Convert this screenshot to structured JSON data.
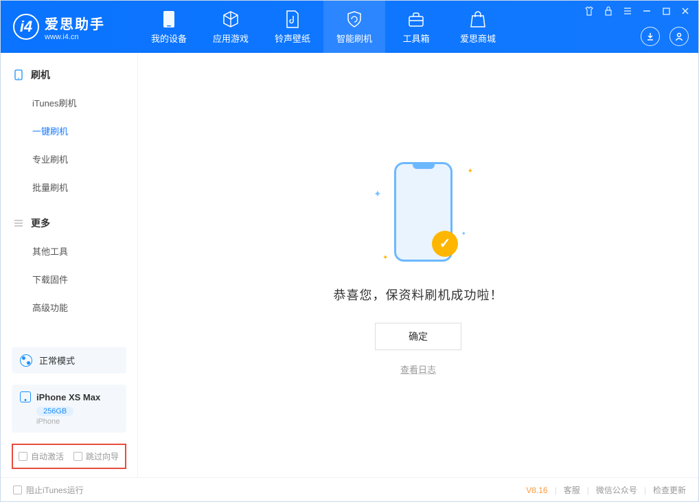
{
  "app": {
    "name": "爱思助手",
    "url": "www.i4.cn"
  },
  "nav": [
    {
      "label": "我的设备"
    },
    {
      "label": "应用游戏"
    },
    {
      "label": "铃声壁纸"
    },
    {
      "label": "智能刷机"
    },
    {
      "label": "工具箱"
    },
    {
      "label": "爱思商城"
    }
  ],
  "sidebar": {
    "section1": {
      "title": "刷机",
      "items": [
        "iTunes刷机",
        "一键刷机",
        "专业刷机",
        "批量刷机"
      ]
    },
    "section2": {
      "title": "更多",
      "items": [
        "其他工具",
        "下载固件",
        "高级功能"
      ]
    }
  },
  "mode": {
    "label": "正常模式"
  },
  "device": {
    "name": "iPhone XS Max",
    "storage": "256GB",
    "type": "iPhone"
  },
  "checkboxes": {
    "auto_activate": "自动激活",
    "skip_guide": "跳过向导"
  },
  "main": {
    "success_message": "恭喜您，保资料刷机成功啦！",
    "ok_button": "确定",
    "view_log": "查看日志"
  },
  "footer": {
    "stop_itunes": "阻止iTunes运行",
    "version": "V8.16",
    "support": "客服",
    "wechat": "微信公众号",
    "check_update": "检查更新"
  }
}
